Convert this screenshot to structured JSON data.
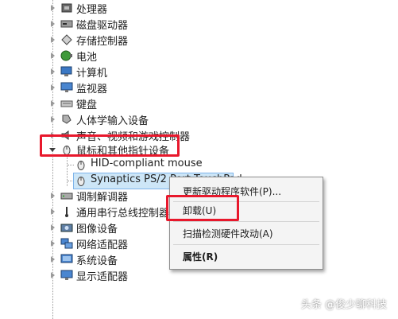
{
  "tree": {
    "items": [
      {
        "label": "处理器",
        "icon": "cpu-icon"
      },
      {
        "label": "磁盘驱动器",
        "icon": "disk-drive-icon"
      },
      {
        "label": "存储控制器",
        "icon": "storage-controller-icon"
      },
      {
        "label": "电池",
        "icon": "battery-icon"
      },
      {
        "label": "计算机",
        "icon": "computer-icon"
      },
      {
        "label": "监视器",
        "icon": "monitor-icon"
      },
      {
        "label": "键盘",
        "icon": "keyboard-icon"
      },
      {
        "label": "人体学输入设备",
        "icon": "hid-icon"
      },
      {
        "label": "声音、视频和游戏控制器",
        "icon": "sound-icon"
      },
      {
        "label": "鼠标和其他指针设备",
        "icon": "mouse-icon"
      },
      {
        "label": "HID-compliant mouse",
        "icon": "mouse-icon"
      },
      {
        "label": "Synaptics PS/2 Port TouchPad",
        "icon": "mouse-icon"
      },
      {
        "label": "调制解调器",
        "icon": "modem-icon"
      },
      {
        "label": "通用串行总线控制器",
        "icon": "usb-icon"
      },
      {
        "label": "图像设备",
        "icon": "camera-icon"
      },
      {
        "label": "网络适配器",
        "icon": "network-adapter-icon"
      },
      {
        "label": "系统设备",
        "icon": "system-device-icon"
      },
      {
        "label": "显示适配器",
        "icon": "display-adapter-icon"
      }
    ]
  },
  "context_menu": {
    "update_driver": "更新驱动程序软件(P)...",
    "uninstall": "卸载(U)",
    "scan_hardware": "扫描检测硬件改动(A)",
    "properties": "属性(R)"
  },
  "watermark": "头条 @俊少聊科技",
  "colors": {
    "highlight": "#e8182c",
    "selection": "#cde6f7"
  }
}
